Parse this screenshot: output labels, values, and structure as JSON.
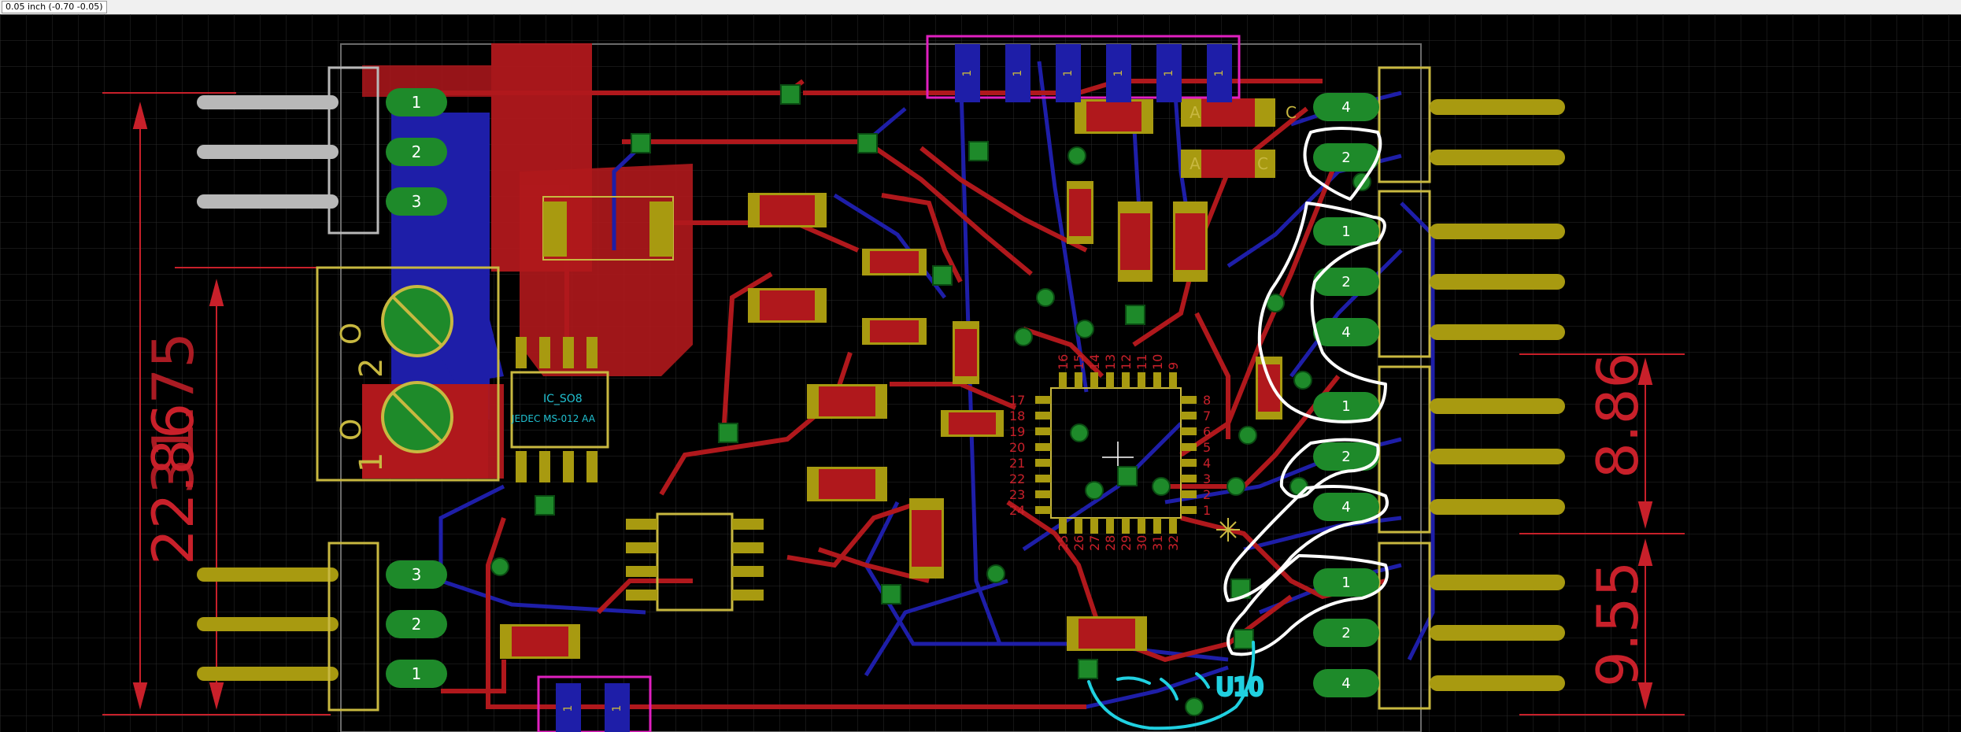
{
  "status": {
    "coordinate_readout": "0.05 inch (-0.70 -0.05)"
  },
  "colors": {
    "background": "#000000",
    "grid": "#2a2a2a",
    "top_copper": "#b0181c",
    "bottom_copper": "#1e1ea8",
    "via_pad": "#1e8a2a",
    "pad_yellow": "#a89a10",
    "outline_silk": "#c8b840",
    "dimension": "#c8202a",
    "frame_magenta": "#e020c0",
    "highlight_white": "#ffffff",
    "highlight_cyan": "#20d0e0"
  },
  "icons": {
    "crosshair": "crosshair-icon",
    "star": "star-icon",
    "via": "via-icon"
  },
  "dimensions": {
    "vertical_left": "22.86",
    "vertical_left_overlap": "31.75",
    "vertical_right_top": "8.86",
    "vertical_right_bottom": "9.55"
  },
  "labels": {
    "ic_package": "IC_SO8",
    "ic_jedec": "JEDEC MS-012 AA",
    "qfn_top_pins": [
      "16",
      "15",
      "14",
      "13",
      "12",
      "11",
      "10",
      "9"
    ],
    "qfn_left_pins": [
      "17",
      "18",
      "19",
      "20",
      "21",
      "22",
      "23",
      "24"
    ],
    "qfn_right_pins": [
      "8",
      "7",
      "6",
      "5",
      "4",
      "3",
      "2",
      "1"
    ],
    "qfn_bottom_pins": [
      "25",
      "26",
      "27",
      "28",
      "29",
      "30",
      "31",
      "32"
    ],
    "left_top_header": [
      "1",
      "2",
      "3"
    ],
    "left_bottom_header": [
      "3",
      "2",
      "1"
    ],
    "right_header_pins": [
      "4",
      "2",
      "1",
      "2",
      "4",
      "1",
      "2",
      "4",
      "1",
      "2",
      "4"
    ],
    "regulator_pin1": "1",
    "regulator_pin2": "2",
    "regulator_pin3": "O",
    "regulator_pin4": "O",
    "led_labels": [
      "C",
      "A",
      "C",
      "A"
    ],
    "header_top_pins": [
      "1",
      "1",
      "1",
      "1",
      "1",
      "1"
    ],
    "header_bottom_pins": [
      "1",
      "1"
    ],
    "component_value": "U10"
  }
}
